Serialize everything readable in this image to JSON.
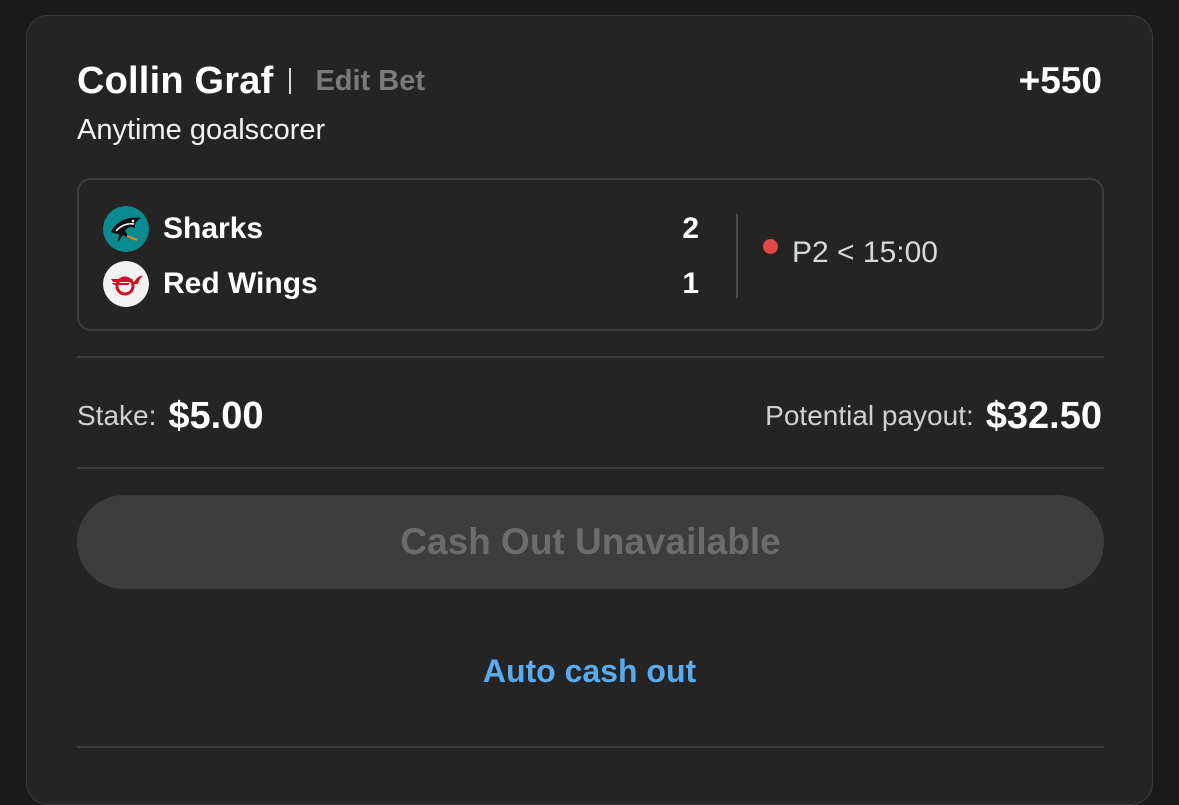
{
  "bet": {
    "player": "Collin Graf",
    "edit_label": "Edit Bet",
    "odds": "+550",
    "market": "Anytime goalscorer"
  },
  "game": {
    "teams": [
      {
        "name": "Sharks",
        "score": "2",
        "logo_icon": "sharks-logo-icon",
        "logo_color": "#0b8a8f"
      },
      {
        "name": "Red Wings",
        "score": "1",
        "logo_icon": "red-wings-logo-icon",
        "logo_color": "#ce1126"
      }
    ],
    "live_indicator_color": "#e04848",
    "clock": "P2 < 15:00"
  },
  "wager": {
    "stake_label": "Stake:",
    "stake_value": "$5.00",
    "payout_label": "Potential payout:",
    "payout_value": "$32.50"
  },
  "actions": {
    "cashout_label": "Cash Out Unavailable",
    "auto_cashout_label": "Auto cash out",
    "accent_color": "#5aabee"
  }
}
